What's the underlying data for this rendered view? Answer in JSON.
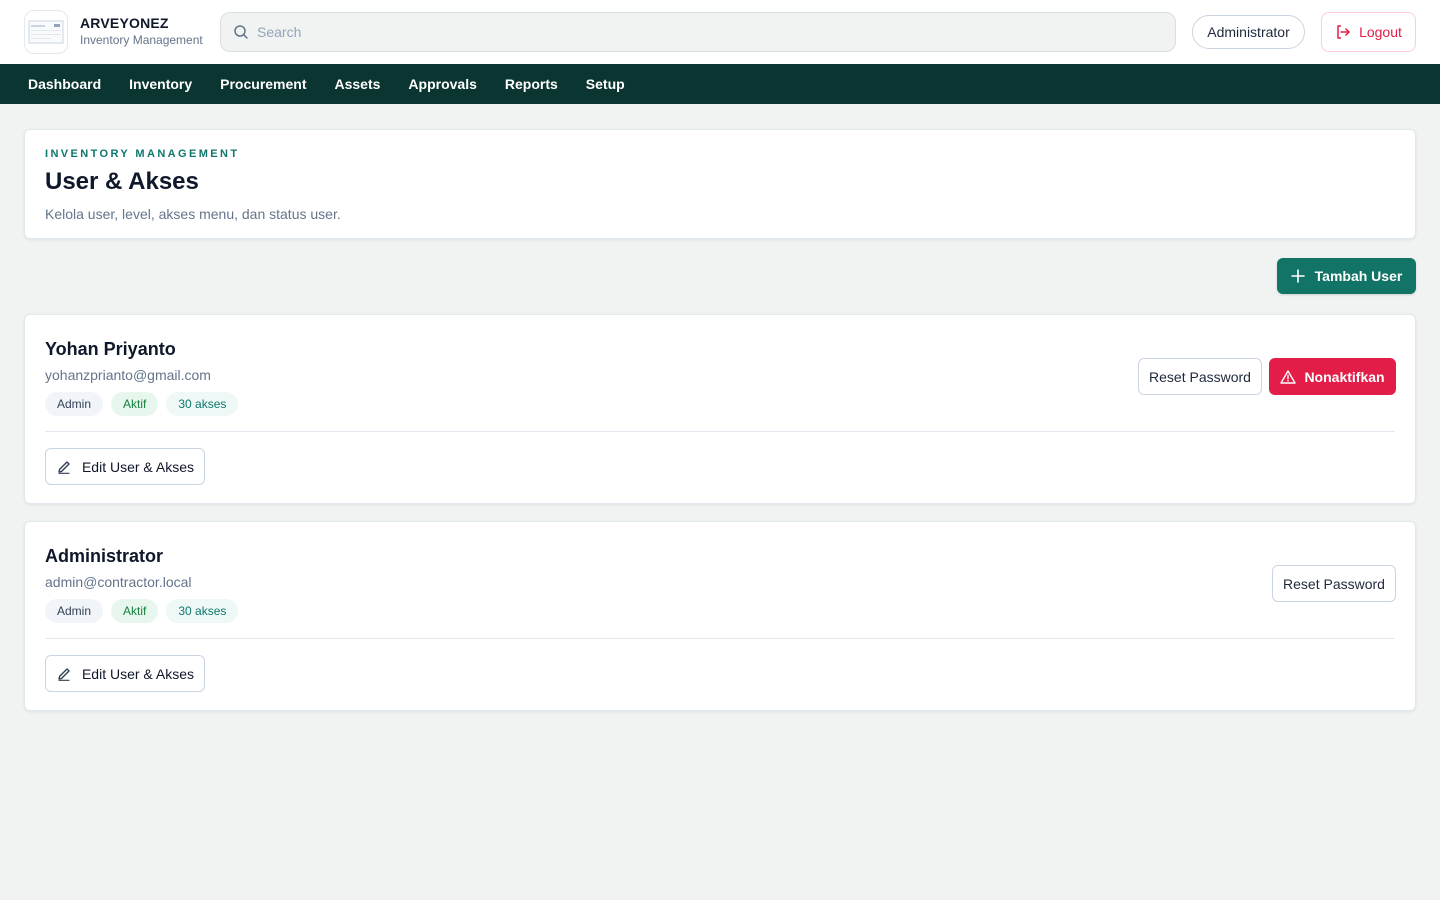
{
  "app": {
    "brand_name": "ARVEYONEZ",
    "brand_subtitle": "Inventory Management"
  },
  "header": {
    "search_placeholder": "Search",
    "search_value": "",
    "user_label": "Administrator",
    "logout_label": "Logout"
  },
  "nav": {
    "items": [
      {
        "label": "Dashboard"
      },
      {
        "label": "Inventory"
      },
      {
        "label": "Procurement"
      },
      {
        "label": "Assets"
      },
      {
        "label": "Approvals"
      },
      {
        "label": "Reports"
      },
      {
        "label": "Setup"
      }
    ]
  },
  "page": {
    "eyebrow": "INVENTORY MANAGEMENT",
    "title": "User & Akses",
    "description": "Kelola user, level, akses menu, dan status user.",
    "add_button_label": "Tambah User"
  },
  "users": [
    {
      "name": "Yohan Priyanto",
      "email": "yohanzprianto@gmail.com",
      "role": "Admin",
      "status": "Aktif",
      "access": "30 akses",
      "reset_label": "Reset Password",
      "deactivate_label": "Nonaktifkan",
      "edit_label": "Edit User & Akses"
    },
    {
      "name": "Administrator",
      "email": "admin@contractor.local",
      "role": "Admin",
      "status": "Aktif",
      "access": "30 akses",
      "reset_label": "Reset Password",
      "edit_label": "Edit User & Akses"
    }
  ],
  "colors": {
    "nav_bg": "#0b3530",
    "primary": "#127466",
    "danger": "#e11d48",
    "page_bg": "#f1f3f3"
  }
}
